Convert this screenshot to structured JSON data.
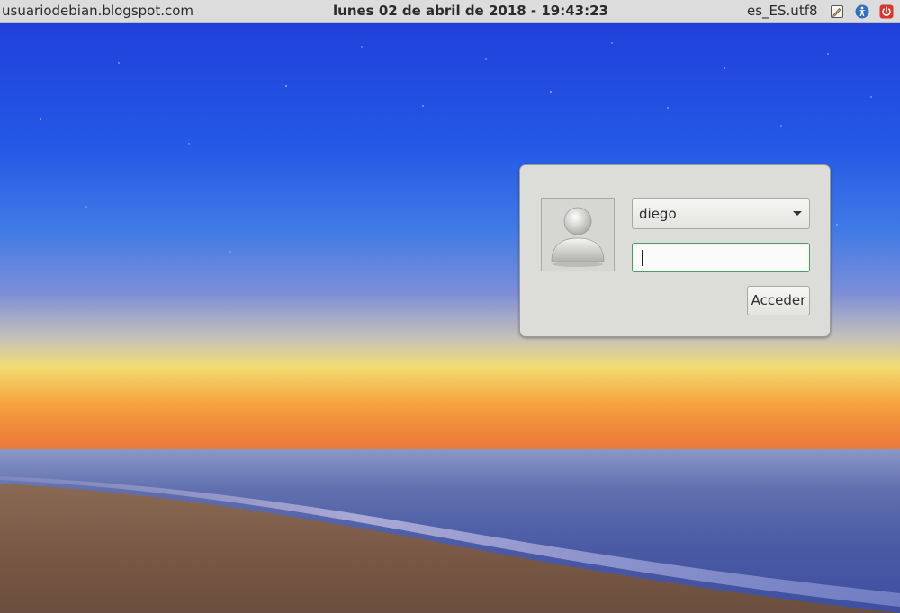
{
  "panel": {
    "hostname": "usuariodebian.blogspot.com",
    "datetime": "lunes 02 de abril de 2018 - 19:43:23",
    "locale": "es_ES.utf8",
    "tray_icons": [
      "session-icon",
      "accessibility-icon",
      "power-icon"
    ]
  },
  "login": {
    "selected_user": "diego",
    "password_value": "",
    "login_button_label": "Acceder"
  },
  "colors": {
    "panel_bg": "#dcdcdc",
    "dialog_bg": "#dcdcd8",
    "focus_border": "#4a9c62",
    "accessibility_icon": "#2f6fc4",
    "power_icon": "#d9352b"
  }
}
